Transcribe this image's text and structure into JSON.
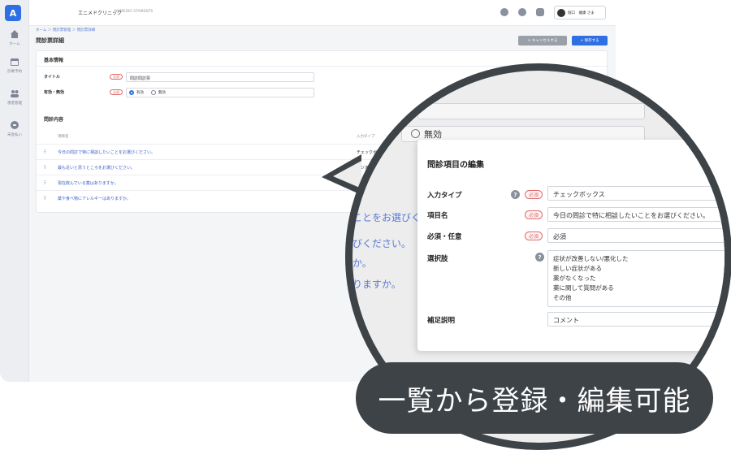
{
  "app": {
    "logo_text": "A",
    "clinic_name": "エニメドクリニック",
    "clinic_sub": "ANIMEDIO STAMENTS",
    "user_name": "堀口　雅康 さま",
    "breadcrumb": "ホーム ＞ 問診票管理 ＞ 問診票詳細",
    "page_title": "問診票詳細",
    "cancel_label": "× キャンセルする",
    "save_label": "+ 保存する",
    "accent_color": "#2f6fe4"
  },
  "sidebar": {
    "items": [
      {
        "label": "ホーム",
        "icon": "home-icon"
      },
      {
        "label": "診療予約",
        "icon": "calendar-icon"
      },
      {
        "label": "患者管理",
        "icon": "users-icon"
      },
      {
        "label": "未会払い",
        "icon": "payment-icon"
      }
    ]
  },
  "basic_info": {
    "section_title": "基本情報",
    "title_label": "タイトル",
    "title_value": "問診問診票",
    "enabled_label": "有効・無効",
    "required_badge": "必須",
    "option_on": "有効",
    "option_off": "無効"
  },
  "questions": {
    "section_title": "問診内容",
    "col_item": "項目名",
    "col_type": "入力タイプ",
    "rows": [
      {
        "text": "今日の問診で特に相談したいことをお選びください。",
        "type": "チェックボ"
      },
      {
        "text": "最も近いと思うところをお選びください。",
        "type": "ラジオ"
      },
      {
        "text": "現在飲んでいる薬はありますか。",
        "type": ""
      },
      {
        "text": "薬や食べ物にアレルギーはありますか。",
        "type": ""
      }
    ]
  },
  "zoom": {
    "bg_texts": [
      "ことをお選びください。",
      "びください。",
      "か。",
      "りますか。"
    ],
    "bg_off": "無効",
    "modal_title": "問診項目の編集",
    "input_type_label": "入力タイプ",
    "input_type_value": "チェックボックス",
    "item_name_label": "項目名",
    "item_name_value": "今日の問診で特に相談したいことをお選びください。",
    "required_label": "必須・任意",
    "required_value": "必須",
    "choices_label": "選択肢",
    "choices": [
      "症状が改善しない/悪化した",
      "新しい症状がある",
      "薬がなくなった",
      "薬に関して質問がある",
      "その他"
    ],
    "note_label": "補足説明",
    "note_value": "コメント",
    "required_badge": "必須",
    "help_mark": "?"
  },
  "caption": "一覧から登録・編集可能"
}
